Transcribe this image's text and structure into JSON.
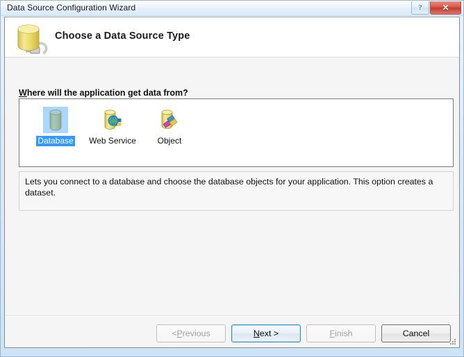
{
  "window": {
    "title": "Data Source Configuration Wizard",
    "help_button_label": "?",
    "close_button_label": "✕"
  },
  "header": {
    "title": "Choose a Data Source Type",
    "icon": "database-plug-icon"
  },
  "prompt": {
    "label_accesskey": "W",
    "label_rest": "here will the application get data from?"
  },
  "source_types": [
    {
      "label": "Database",
      "icon": "database-cylinder-icon",
      "selected": true
    },
    {
      "label": "Web Service",
      "icon": "web-service-globe-icon",
      "selected": false
    },
    {
      "label": "Object",
      "icon": "object-shapes-icon",
      "selected": false
    }
  ],
  "description": {
    "text": "Lets you connect to a database and choose the database objects for your application. This option creates a dataset."
  },
  "buttons": {
    "previous": {
      "prefix": "< ",
      "accesskey": "P",
      "rest": "revious",
      "enabled": false
    },
    "next": {
      "prefix": "",
      "accesskey": "N",
      "rest": "ext >",
      "enabled": true,
      "is_default": true
    },
    "finish": {
      "prefix": "",
      "accesskey": "F",
      "rest": "inish",
      "enabled": false
    },
    "cancel": {
      "prefix": "",
      "accesskey": "",
      "rest": "Cancel",
      "enabled": true
    }
  },
  "colors": {
    "selection_blue": "#3399ff",
    "default_button_border": "#2c8fd4",
    "close_button_red": "#c23a2c",
    "client_background": "#f5f5f5"
  }
}
